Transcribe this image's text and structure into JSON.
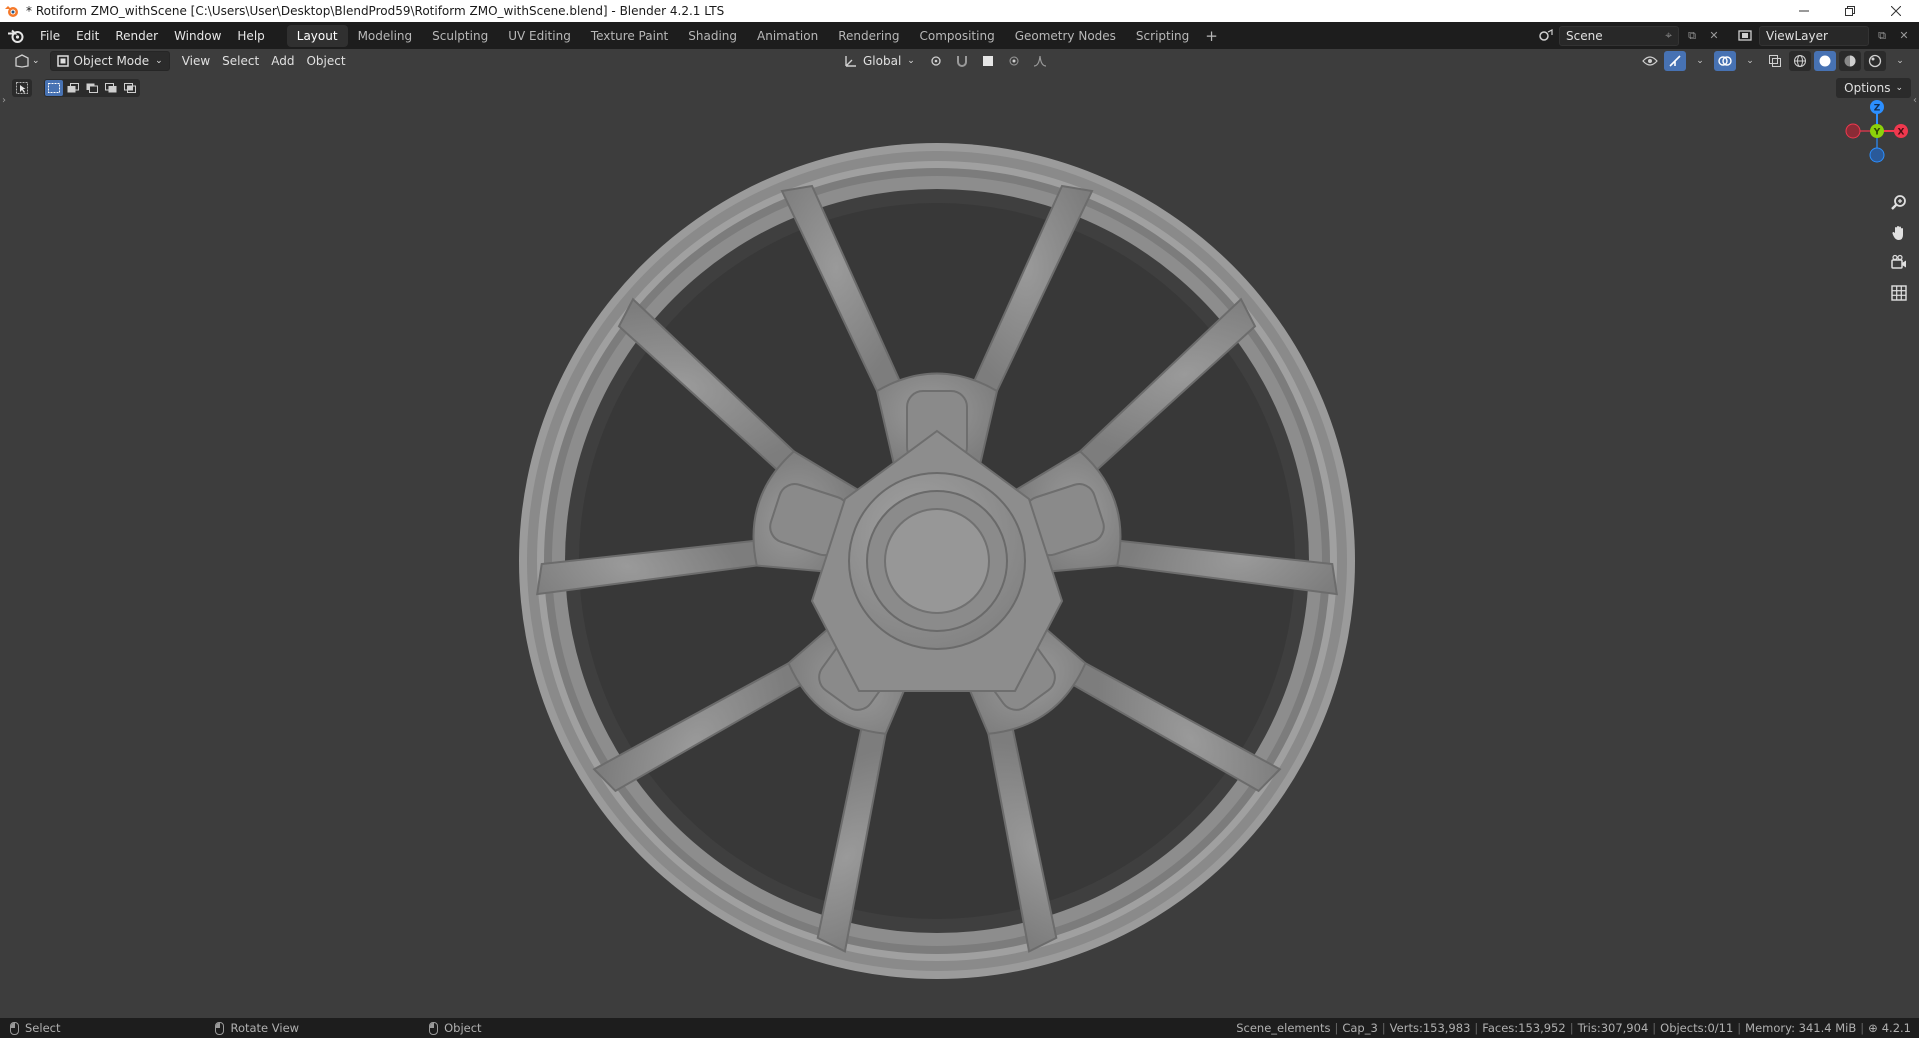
{
  "window": {
    "title": "* Rotiform ZMO_withScene [C:\\Users\\User\\Desktop\\BlendProd59\\Rotiform ZMO_withScene.blend] - Blender 4.2.1 LTS"
  },
  "menu": {
    "items": [
      "File",
      "Edit",
      "Render",
      "Window",
      "Help"
    ]
  },
  "workspaces": {
    "tabs": [
      "Layout",
      "Modeling",
      "Sculpting",
      "UV Editing",
      "Texture Paint",
      "Shading",
      "Animation",
      "Rendering",
      "Compositing",
      "Geometry Nodes",
      "Scripting"
    ],
    "active": "Layout",
    "add_label": "+"
  },
  "scene": {
    "scene_name": "Scene",
    "view_layer": "ViewLayer"
  },
  "viewport_header": {
    "mode": "Object Mode",
    "menus": [
      "View",
      "Select",
      "Add",
      "Object"
    ],
    "transform_orientation": "Global"
  },
  "viewport": {
    "options_label": "Options",
    "gizmo": {
      "z_label": "Z",
      "y_label": "Y",
      "x_label": "X",
      "colors": {
        "x": "#f0384e",
        "y": "#8cd20a",
        "z": "#2c8fff"
      }
    },
    "background_color": "#3d3d3d",
    "model_color": "#8c8c8c"
  },
  "statusbar": {
    "select_label": "Select",
    "rotate_label": "Rotate View",
    "object_label": "Object",
    "collection": "Scene_elements",
    "active_object": "Cap_3",
    "verts": "Verts:153,983",
    "faces": "Faces:153,952",
    "tris": "Tris:307,904",
    "objects": "Objects:0/11",
    "memory": "Memory: 341.4 MiB",
    "version": "4.2.1"
  }
}
